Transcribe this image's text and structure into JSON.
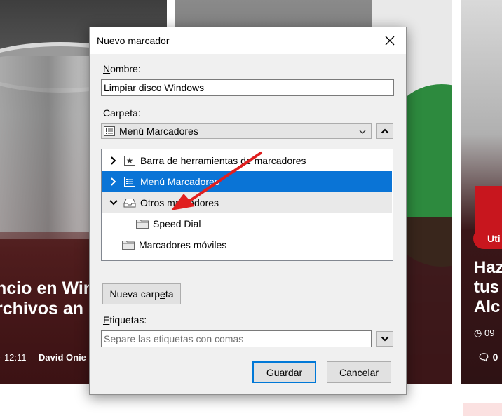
{
  "background": {
    "left_headline_line1": "ncio en Win",
    "left_headline_line2": "rchivos an",
    "left_time": "- 12:11",
    "left_author": "David Onie",
    "right_badge": "Uti",
    "right_headline_line1": "Haz",
    "right_headline_line2": "tus",
    "right_headline_line3": "Alc",
    "right_date": "09",
    "right_comments": "0"
  },
  "dialog": {
    "title": "Nuevo marcador",
    "name_label_first": "N",
    "name_label_rest": "ombre:",
    "name_value": "Limpiar disco Windows",
    "folder_label": "Carpeta:",
    "folder_selected": "Menú Marcadores",
    "tree": [
      {
        "label": "Barra de herramientas de marcadores",
        "icon": "star-folder-icon",
        "expander": "chevron-right"
      },
      {
        "label": "Menú Marcadores",
        "icon": "menu-list-icon",
        "expander": "chevron-right",
        "selected": true
      },
      {
        "label": "Otros marcadores",
        "icon": "tray-icon",
        "expander": "chevron-down"
      },
      {
        "label": "Speed Dial",
        "icon": "folder-icon",
        "expander": "none"
      },
      {
        "label": "Marcadores móviles",
        "icon": "folder-icon",
        "expander": "none"
      }
    ],
    "new_folder_pre": "Nueva carp",
    "new_folder_u": "e",
    "new_folder_post": "ta",
    "tags_label_first": "E",
    "tags_label_rest": "tiquetas:",
    "tags_placeholder": "Separe las etiquetas con comas",
    "save_label": "Guardar",
    "cancel_label": "Cancelar"
  },
  "colors": {
    "selection": "#0a74d6",
    "default_button_border": "#0078d7",
    "annotation_arrow": "#e01f1f"
  }
}
